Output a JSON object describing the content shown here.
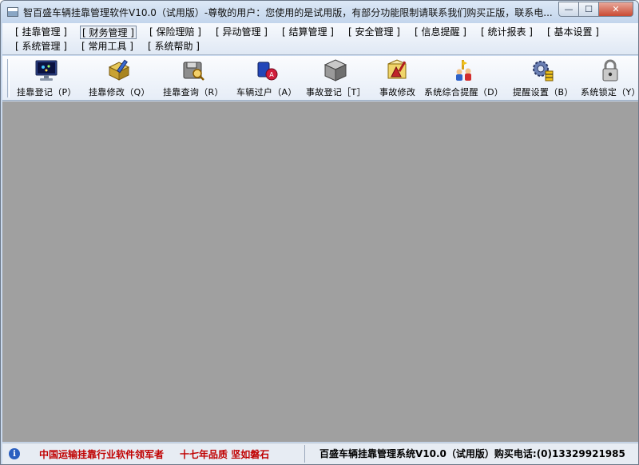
{
  "window": {
    "title": "智百盛车辆挂靠管理软件V10.0（试用版）-尊敬的用户：您使用的是试用版，有部分功能限制请联系我们购买正版，联系电...",
    "caption": {
      "minimize": "—",
      "maximize": "☐",
      "close": "✕"
    }
  },
  "menu": {
    "row1": [
      {
        "label": "[ 挂靠管理 ]"
      },
      {
        "label": "[ 财务管理 ]"
      },
      {
        "label": "[ 保险理赔 ]"
      },
      {
        "label": "[ 异动管理 ]"
      },
      {
        "label": "[ 结算管理 ]"
      },
      {
        "label": "[ 安全管理 ]"
      },
      {
        "label": "[ 信息提醒 ]"
      },
      {
        "label": "[ 统计报表 ]"
      },
      {
        "label": "[ 基本设置 ]"
      }
    ],
    "row2": [
      {
        "label": "[ 系统管理 ]"
      },
      {
        "label": "[ 常用工具 ]"
      },
      {
        "label": "[ 系统帮助 ]"
      }
    ]
  },
  "toolbar": {
    "items": [
      {
        "label": "挂靠登记（P）",
        "icon": "monitor-icon"
      },
      {
        "label": "挂靠修改（Q）",
        "icon": "edit-box-icon"
      },
      {
        "label": "挂靠查询（R）",
        "icon": "search-disk-icon"
      },
      {
        "label": "车辆过户（A）",
        "icon": "transfer-icon"
      },
      {
        "label": "事故登记［T］",
        "icon": "cube-icon"
      },
      {
        "label": "事故修改",
        "icon": "accident-edit-icon"
      },
      {
        "label": "系统综合提醒（D）",
        "icon": "alert-people-icon"
      },
      {
        "label": "提醒设置（B）",
        "icon": "gear-settings-icon"
      },
      {
        "label": "系统锁定（Y）",
        "icon": "lock-icon"
      }
    ]
  },
  "status": {
    "slogan1": "中国运输挂靠行业软件领军者",
    "slogan2": "十七年品质 坚如磐石",
    "product": "百盛车辆挂靠管理系统V10.0（试用版）购买电话:(0)13329921985",
    "colors": {
      "slogan": "#c00000",
      "client_bg": "#a0a0a0"
    }
  }
}
